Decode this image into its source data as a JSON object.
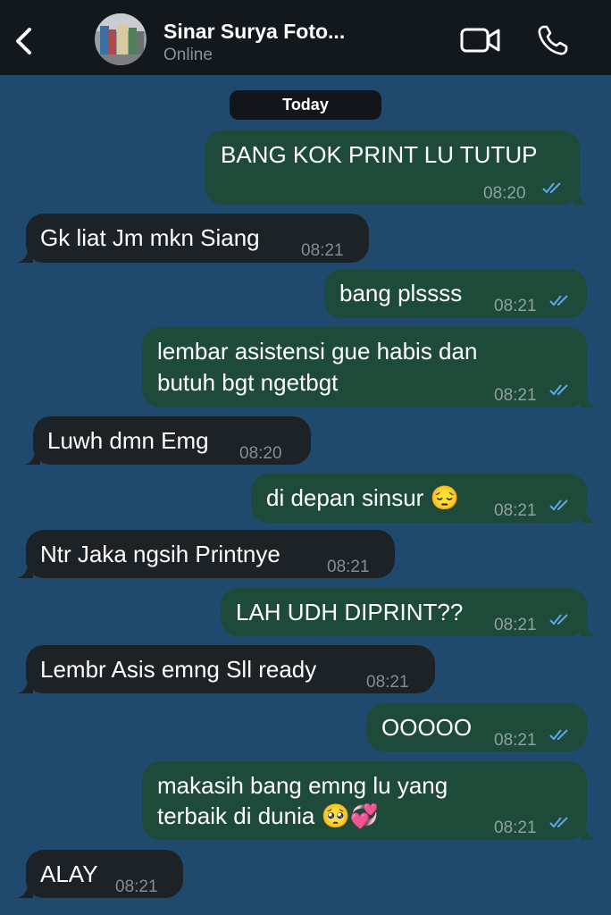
{
  "header": {
    "contact_name": "Sinar Surya Foto...",
    "status": "Online"
  },
  "date_separator": "Today",
  "messages": [
    {
      "dir": "out",
      "text": "BANG KOK PRINT LU TUTUP",
      "time": "08:20"
    },
    {
      "dir": "in",
      "text": "Gk liat Jm mkn Siang",
      "time": "08:21"
    },
    {
      "dir": "out",
      "text": "bang plssss",
      "time": "08:21"
    },
    {
      "dir": "out",
      "text_line1": "lembar asistensi gue habis dan",
      "text_line2": "butuh bgt ngetbgt",
      "time": "08:21"
    },
    {
      "dir": "in",
      "text": "Luwh dmn Emg",
      "time": "08:20"
    },
    {
      "dir": "out",
      "text": "di depan sinsur 😔",
      "time": "08:21"
    },
    {
      "dir": "in",
      "text": "Ntr Jaka ngsih Printnye",
      "time": "08:21"
    },
    {
      "dir": "out",
      "text": "LAH UDH DIPRINT??",
      "time": "08:21"
    },
    {
      "dir": "in",
      "text": "Lembr Asis emng Sll ready",
      "time": "08:21"
    },
    {
      "dir": "out",
      "text": "OOOOO",
      "time": "08:21"
    },
    {
      "dir": "out",
      "text_line1": "makasih bang emng lu yang",
      "text_line2": "terbaik di dunia 🥺💞",
      "time": "08:21"
    },
    {
      "dir": "in",
      "text": "ALAY",
      "time": "08:21"
    }
  ],
  "colors": {
    "background": "#1f4a6e",
    "outgoing_bubble": "#1e4a3a",
    "incoming_bubble": "#1d2227",
    "header": "#13181d",
    "read_ticks": "#5fa8e8"
  },
  "icons": {
    "back": "chevron-left-icon",
    "video": "video-camera-icon",
    "phone": "phone-icon",
    "read_receipt": "double-check-icon"
  }
}
